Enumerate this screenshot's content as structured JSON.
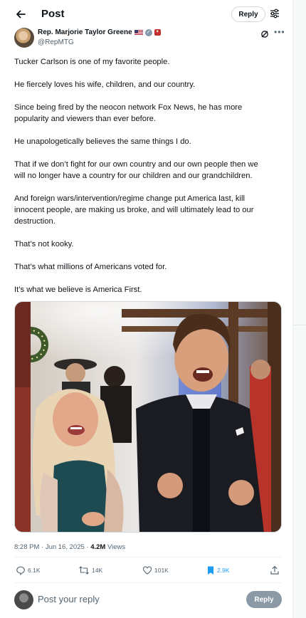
{
  "header": {
    "title": "Post",
    "reply_label": "Reply"
  },
  "author": {
    "name": "Rep. Marjorie Taylor Greene",
    "handle": "@RepMTG"
  },
  "tweet": {
    "paragraphs": [
      "Tucker Carlson is one of my favorite people.",
      "He fiercely loves his wife, children, and our country.",
      "Since being fired by the neocon network Fox News, he has more",
      "popularity and viewers than ever before.",
      "He unapologetically believes the same things I do.",
      "That if we don’t fight for our own country and our own people then we",
      "will no longer have a country for our children and our grandchildren.",
      "And foreign wars/intervention/regime change put America last, kill",
      "innocent people, are making us broke, and will ultimately lead to our",
      "destruction.",
      "That’s not kooky.",
      "That’s what millions of Americans voted for.",
      "It’s what we believe is America First."
    ]
  },
  "meta": {
    "time": "8:28 PM · Jun 16, 2025 · ",
    "views_count": "4.2M",
    "views_label": " Views"
  },
  "actions": {
    "replies": "6.1K",
    "reposts": "14K",
    "likes": "101K",
    "bookmarks": "2.9K"
  },
  "compose": {
    "placeholder": "Post your reply",
    "reply_label": "Reply"
  },
  "colors": {
    "text": "#0f1419",
    "secondary": "#536471",
    "bookmark_active": "#1d9bf0",
    "reply_button_disabled": "#8b98a5"
  },
  "icons": [
    "back-arrow-icon",
    "filter-icon",
    "verified-icon",
    "government-badge-icon",
    "grok-icon",
    "more-icon",
    "reply-icon",
    "repost-icon",
    "like-icon",
    "bookmark-icon",
    "share-icon"
  ]
}
